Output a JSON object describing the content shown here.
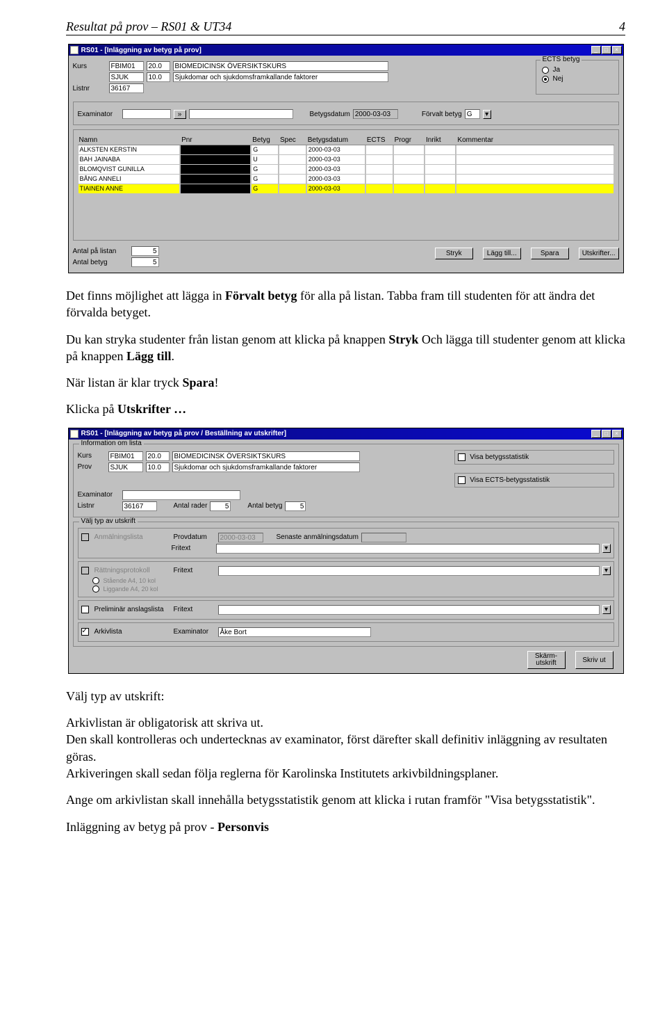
{
  "header": {
    "title": "Resultat på prov – RS01 & UT34",
    "page_no": "4"
  },
  "paras": {
    "p1_pre": "Det finns möjlighet att lägga in ",
    "p1_bold": "Förvalt betyg",
    "p1_post": " för alla på listan. Tabba fram till studenten för att ändra det förvalda betyget.",
    "p2_pre": "Du kan stryka studenter från listan genom att klicka på knappen ",
    "p2_b1": "Stryk",
    "p2_mid": " Och lägga till studenter genom att klicka på knappen ",
    "p2_b2": "Lägg till",
    "p2_post": ".",
    "p3_pre": "När listan är klar tryck ",
    "p3_b": "Spara",
    "p3_post": "!",
    "p4_pre": "Klicka på ",
    "p4_b": "Utskrifter …",
    "p5": "Välj typ av utskrift:",
    "p6": "Arkivlistan är obligatorisk att skriva ut.\nDen skall kontrolleras och undertecknas av examinator, först därefter skall definitiv inläggning av resultaten göras.\nArkiveringen skall sedan följa reglerna för Karolinska Institutets arkivbildningsplaner.",
    "p7": "Ange om arkivlistan skall innehålla betygsstatistik genom att klicka i rutan framför \"Visa betygsstatistik\".",
    "p8_pre": "Inläggning av betyg på prov - ",
    "p8_b": "Personvis"
  },
  "app1": {
    "title": "RS01 - [Inläggning av betyg på prov]",
    "labels": {
      "kurs": "Kurs",
      "listnr": "Listnr",
      "examinator": "Examinator",
      "betygsdatum": "Betygsdatum",
      "forvalt_betyg": "Förvalt betyg",
      "ects_betyg": "ECTS betyg",
      "ja": "Ja",
      "nej": "Nej",
      "antal_listan": "Antal på listan",
      "antal_betyg": "Antal betyg"
    },
    "kurs": {
      "code": "FBIM01",
      "pts": "20.0",
      "name": "BIOMEDICINSK ÖVERSIKTSKURS"
    },
    "prov": {
      "code": "SJUK",
      "pts": "10.0",
      "name": "Sjukdomar och sjukdomsframkallande faktorer"
    },
    "listnr": "36167",
    "betygsdatum": "2000-03-03",
    "forvalt_betyg": "G",
    "columns": [
      "Namn",
      "Pnr",
      "Betyg",
      "Spec",
      "Betygsdatum",
      "ECTS",
      "Progr",
      "Inrikt",
      "Kommentar"
    ],
    "rows": [
      {
        "namn": "ALKSTEN KERSTIN",
        "betyg": "G",
        "datum": "2000-03-03",
        "hl": false
      },
      {
        "namn": "BAH JAINABA",
        "betyg": "U",
        "datum": "2000-03-03",
        "hl": false
      },
      {
        "namn": "BLOMQVIST GUNILLA",
        "betyg": "G",
        "datum": "2000-03-03",
        "hl": false
      },
      {
        "namn": "BÅNG ANNELI",
        "betyg": "G",
        "datum": "2000-03-03",
        "hl": false
      },
      {
        "namn": "TIAINEN ANNE",
        "betyg": "G",
        "datum": "2000-03-03",
        "hl": true
      }
    ],
    "antal_listan": "5",
    "antal_betyg": "5",
    "buttons": {
      "stryk": "Stryk",
      "laggtill": "Lägg till...",
      "spara": "Spara",
      "utskrifter": "Utskrifter..."
    }
  },
  "app2": {
    "title": "RS01 - [Inläggning av betyg på prov / Beställning av utskrifter]",
    "g_info": "Information om lista",
    "g_valj": "Välj typ av utskrift",
    "labels": {
      "kurs": "Kurs",
      "prov": "Prov",
      "examinator": "Examinator",
      "listnr": "Listnr",
      "antal_rader": "Antal rader",
      "antal_betyg": "Antal betyg",
      "visa_bs": "Visa betygsstatistik",
      "visa_ects": "Visa ECTS-betygsstatistik",
      "anm": "Anmälningslista",
      "provdatum": "Provdatum",
      "senaste": "Senaste anmälningsdatum",
      "fritext": "Fritext",
      "ratt": "Rättningsprotokoll",
      "staende": "Stående A4, 10 kol",
      "liggande": "Liggande A4, 20 kol",
      "prel": "Preliminär anslagslista",
      "arkiv": "Arkivlista",
      "exam": "Examinator"
    },
    "kurs": {
      "code": "FBIM01",
      "pts": "20.0",
      "name": "BIOMEDICINSK ÖVERSIKTSKURS"
    },
    "prov": {
      "code": "SJUK",
      "pts": "10.0",
      "name": "Sjukdomar och sjukdomsframkallande faktorer"
    },
    "listnr": "36167",
    "antal_rader": "5",
    "antal_betyg": "5",
    "provdatum": "2000-03-03",
    "arkiv_examinator": "Åke Bort",
    "buttons": {
      "skarm": "Skärm-\nutskrift",
      "skrivut": "Skriv ut"
    }
  }
}
